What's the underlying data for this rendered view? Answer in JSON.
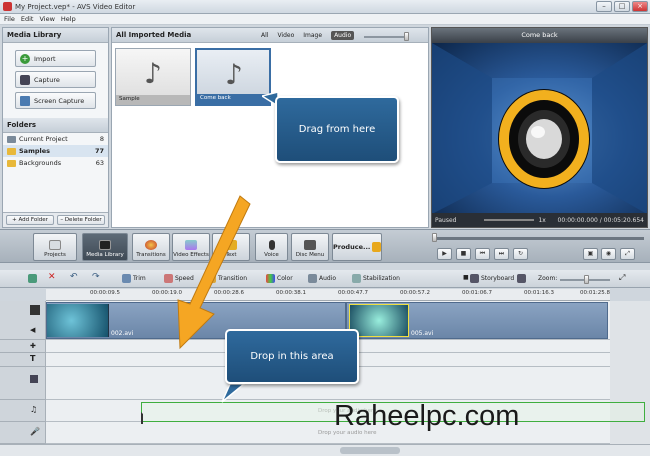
{
  "window": {
    "title": "My Project.vep* - AVS Video Editor"
  },
  "menu": [
    "File",
    "Edit",
    "View",
    "Help"
  ],
  "left_panel": {
    "title": "Media Library",
    "buttons": [
      "Import",
      "Capture",
      "Screen Capture"
    ],
    "folders_title": "Folders",
    "folders": [
      {
        "name": "Current Project",
        "count": "8"
      },
      {
        "name": "Samples",
        "count": "77"
      },
      {
        "name": "Backgrounds",
        "count": "63"
      }
    ],
    "add_folder": "+ Add Folder",
    "delete_folder": "– Delete Folder"
  },
  "media_panel": {
    "title": "All Imported Media",
    "filters": [
      "All",
      "Video",
      "Image",
      "Audio"
    ],
    "items": [
      {
        "label": "Sample"
      },
      {
        "label": "Come back"
      }
    ]
  },
  "preview": {
    "title": "Come back",
    "status": "Paused",
    "speed": "1x",
    "time": "00:00:00.000 / 00:05:20.654"
  },
  "toolbar": {
    "buttons": [
      "Projects",
      "Media Library",
      "Transitions",
      "Video Effects",
      "Text",
      "Voice",
      "Disc Menu",
      "Produce..."
    ]
  },
  "edit_tools": {
    "items": [
      "Trim",
      "Speed",
      "Transition",
      "Color",
      "Audio",
      "Stabilization"
    ],
    "storyboard": "Storyboard",
    "zoom": "Zoom:"
  },
  "ruler": [
    "00:00:09.5",
    "00:00:19.0",
    "00:00:28.6",
    "00:00:38.1",
    "00:00:47.7",
    "00:00:57.2",
    "00:01:06.7",
    "00:01:16.3",
    "00:01:25.8"
  ],
  "timeline": {
    "clips": [
      "002.avi",
      "005.avi"
    ],
    "drop_hints": [
      "Drop your audio here",
      "Drop your audio here"
    ]
  },
  "callouts": {
    "drag": "Drag from here",
    "drop": "Drop in this area"
  },
  "watermark": "Raheelpc.com"
}
